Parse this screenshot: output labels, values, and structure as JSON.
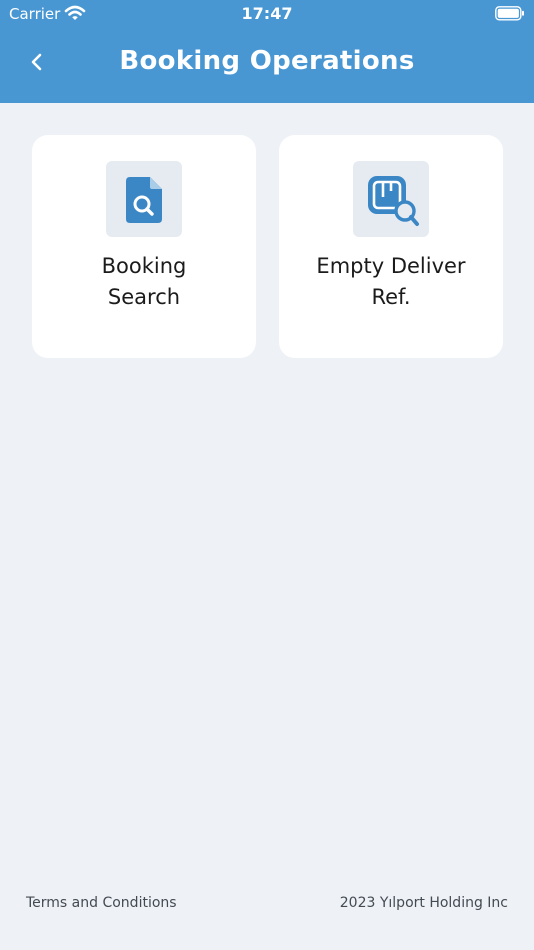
{
  "status_bar": {
    "carrier": "Carrier",
    "time": "17:47"
  },
  "header": {
    "title": "Booking Operations",
    "back_icon": "chevron-left-icon"
  },
  "cards": [
    {
      "label": "Booking\nSearch",
      "icon": "document-search-icon"
    },
    {
      "label": "Empty Deliver\nRef.",
      "icon": "container-search-icon"
    }
  ],
  "footer": {
    "terms": "Terms and Conditions",
    "copyright": "2023 Yılport Holding Inc"
  },
  "colors": {
    "header": "#4897d3",
    "background": "#eef2f7",
    "icon_accent": "#3b87c5"
  }
}
